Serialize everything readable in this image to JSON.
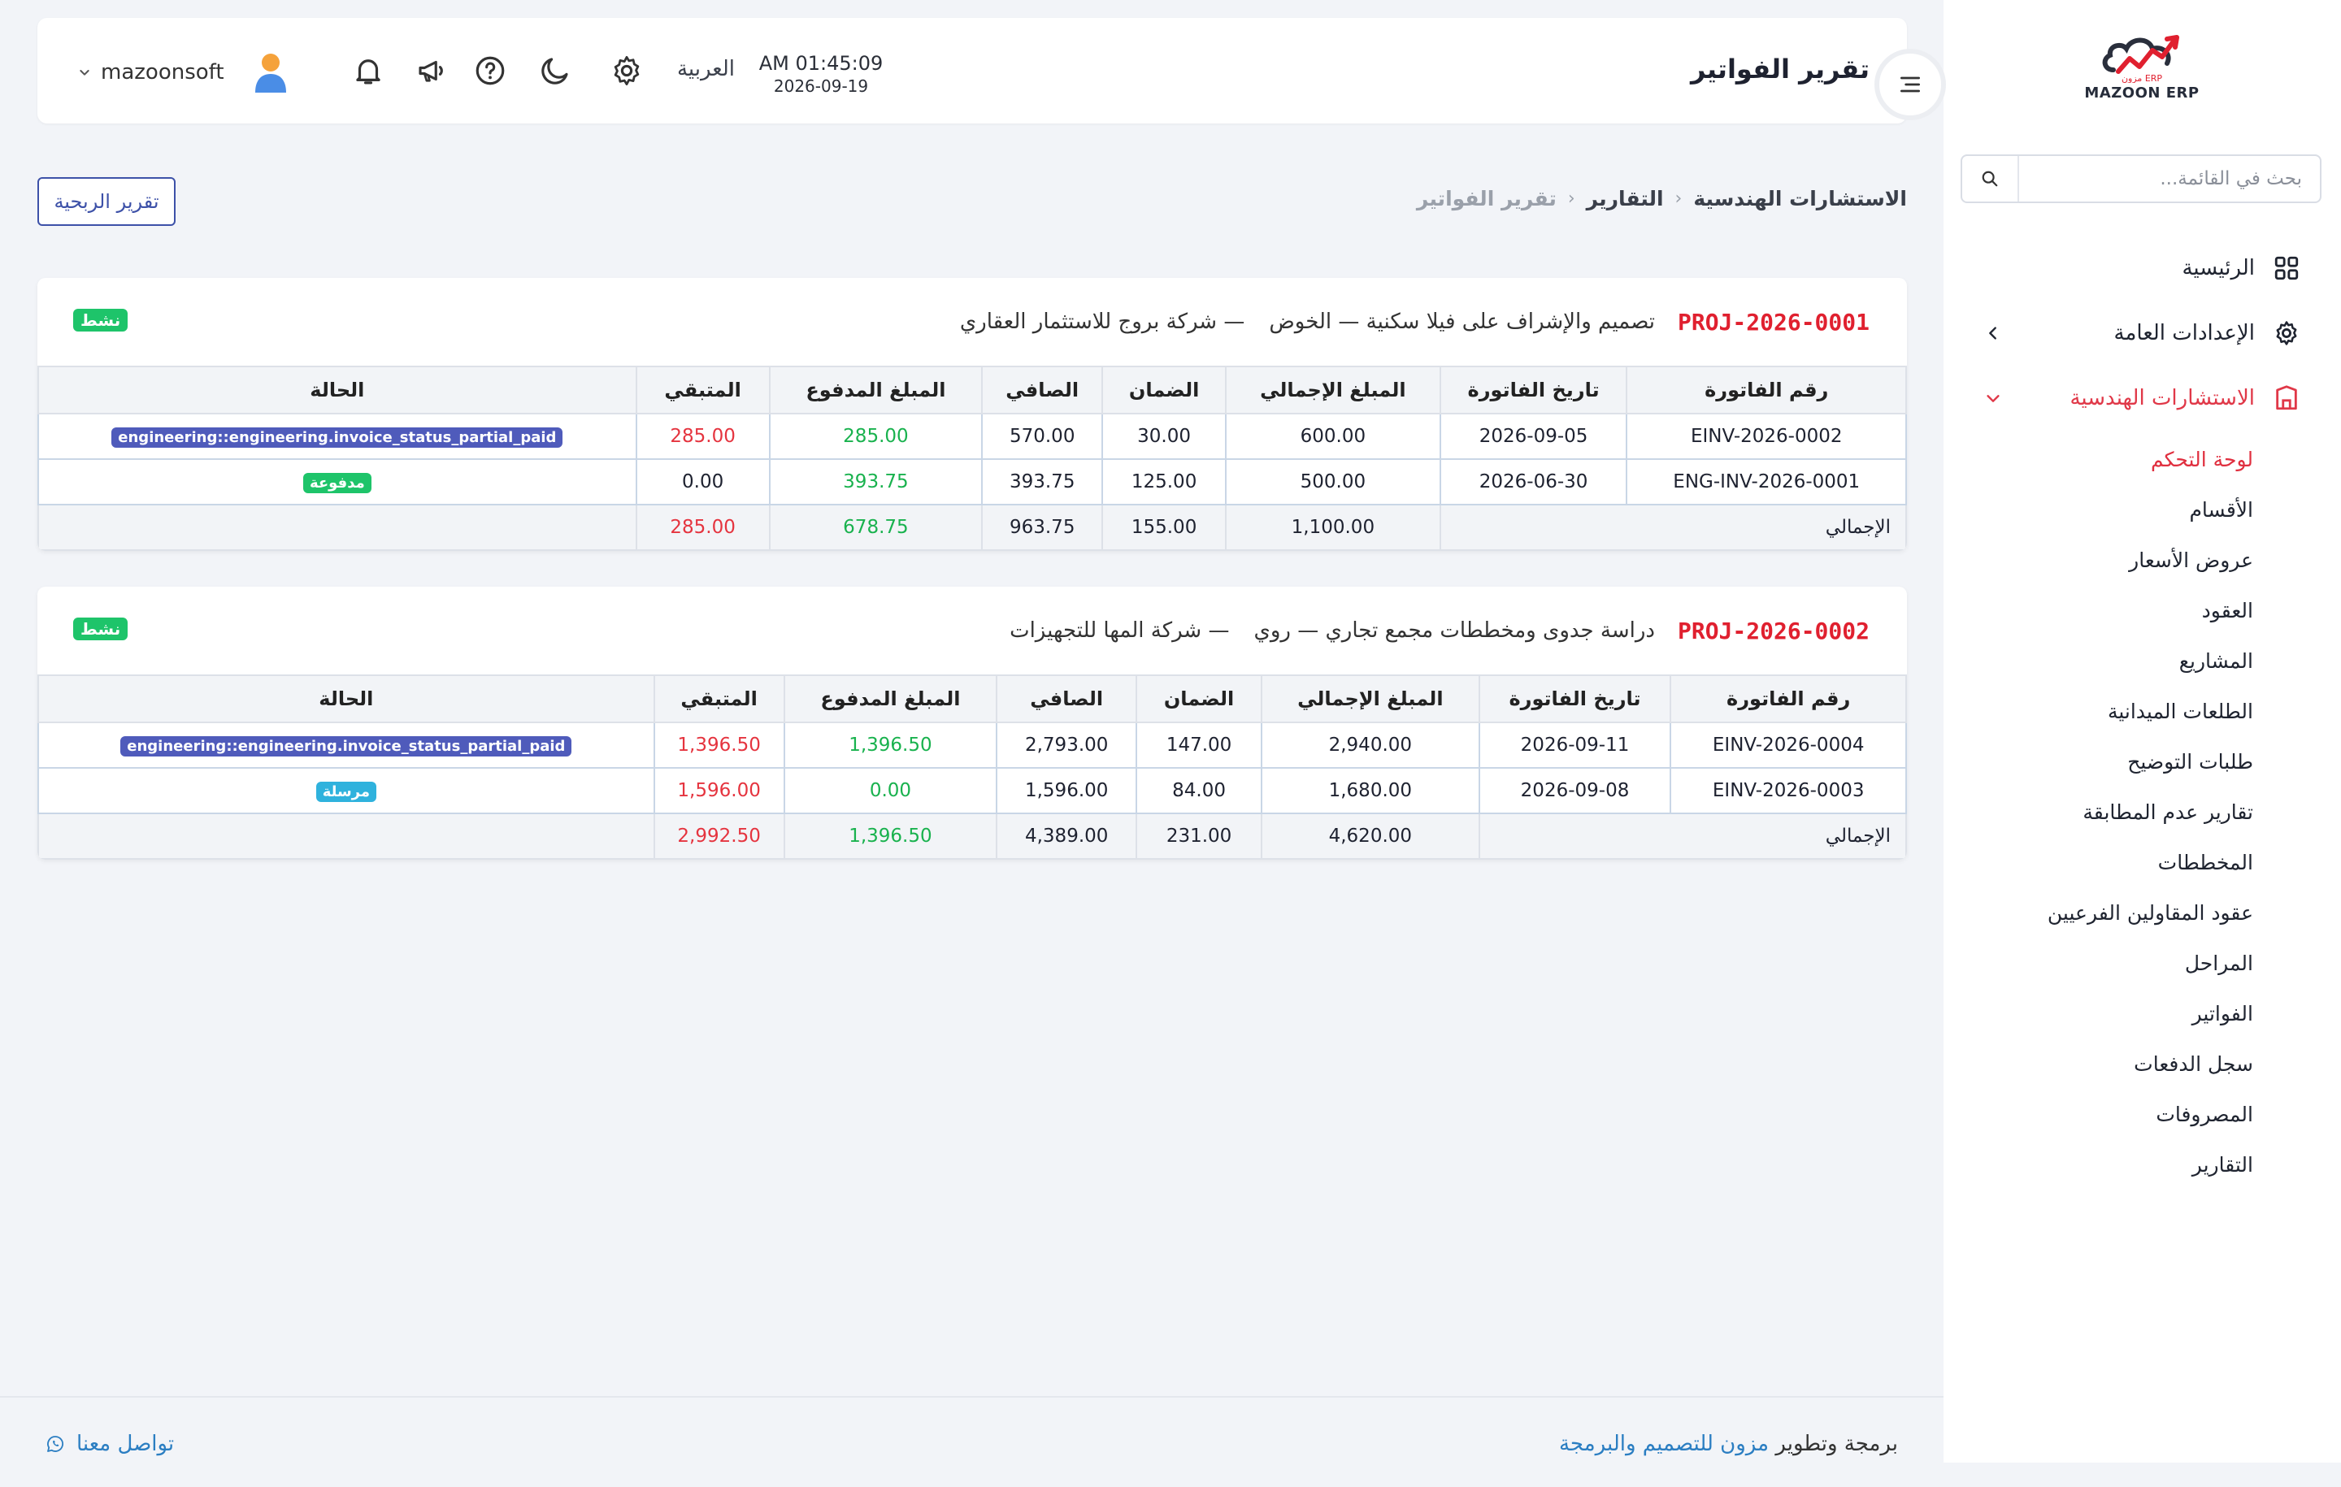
{
  "app": {
    "logo_text": "MAZOON ERP",
    "logo_small": "ERP مزون"
  },
  "sidebar": {
    "search_placeholder": "بحث في القائمة...",
    "items": [
      {
        "label": "الرئيسية",
        "icon": "grid-icon"
      },
      {
        "label": "الإعدادات العامة",
        "icon": "gear-icon"
      },
      {
        "label": "الاستشارات الهندسية",
        "icon": "building-icon",
        "active": true
      }
    ],
    "subitems": [
      "لوحة التحكم",
      "الأقسام",
      "عروض الأسعار",
      "العقود",
      "المشاريع",
      "الطلعات الميدانية",
      "طلبات التوضيح",
      "تقارير عدم المطابقة",
      "المخططات",
      "عقود المقاولين الفرعيين",
      "المراحل",
      "الفواتير",
      "سجل الدفعات",
      "المصروفات",
      "التقارير"
    ]
  },
  "header": {
    "title": "تقرير الفواتير",
    "time": "AM 01:45:09",
    "date": "2026-09-19",
    "language": "العربية",
    "username": "mazoonsoft"
  },
  "breadcrumb": {
    "items": [
      "الاستشارات الهندسية",
      "التقارير",
      "تقرير الفواتير"
    ]
  },
  "actions": {
    "profit_report": "تقرير الربحية"
  },
  "columns": [
    "رقم الفاتورة",
    "تاريخ الفاتورة",
    "المبلغ الإجمالي",
    "الضمان",
    "الصافي",
    "المبلغ المدفوع",
    "المتبقي",
    "الحالة"
  ],
  "total_label": "الإجمالي",
  "projects": [
    {
      "code": "PROJ-2026-0001",
      "name": "تصميم والإشراف على فيلا سكنية — الخوض",
      "client": "— شركة بروج للاستثمار العقاري",
      "badge": "نشط",
      "rows": [
        {
          "number": "EINV-2026-0002",
          "date": "2026-09-05",
          "gross": "600.00",
          "retention": "30.00",
          "net": "570.00",
          "paid": "285.00",
          "remaining": "285.00",
          "status": "engineering::engineering.invoice_status_partial_paid"
        },
        {
          "number": "ENG-INV-2026-0001",
          "date": "2026-06-30",
          "gross": "500.00",
          "retention": "125.00",
          "net": "393.75",
          "paid": "393.75",
          "remaining": "0.00",
          "status": "مدفوعة"
        }
      ],
      "totals": {
        "gross": "1,100.00",
        "retention": "155.00",
        "net": "963.75",
        "paid": "678.75",
        "remaining": "285.00"
      }
    },
    {
      "code": "PROJ-2026-0002",
      "name": "دراسة جدوى ومخططات مجمع تجاري — روي",
      "client": "— شركة المها للتجهيزات",
      "badge": "نشط",
      "rows": [
        {
          "number": "EINV-2026-0004",
          "date": "2026-09-11",
          "gross": "2,940.00",
          "retention": "147.00",
          "net": "2,793.00",
          "paid": "1,396.50",
          "remaining": "1,396.50",
          "status": "engineering::engineering.invoice_status_partial_paid"
        },
        {
          "number": "EINV-2026-0003",
          "date": "2026-09-08",
          "gross": "1,680.00",
          "retention": "84.00",
          "net": "1,596.00",
          "paid": "0.00",
          "remaining": "1,596.00",
          "status": "مرسلة"
        }
      ],
      "totals": {
        "gross": "4,620.00",
        "retention": "231.00",
        "net": "4,389.00",
        "paid": "1,396.50",
        "remaining": "2,992.50"
      }
    }
  ],
  "footer": {
    "credit_prefix": "برمجة وتطوير",
    "credit_link": "مزون للتصميم والبرمجة",
    "contact": "تواصل معنا"
  },
  "colors": {
    "accent_red": "#e0202f",
    "primary_blue": "#3d51a8",
    "success_green": "#1ec46a",
    "partial_badge": "#4f5bbb",
    "sent_badge": "#2fb2dd"
  }
}
